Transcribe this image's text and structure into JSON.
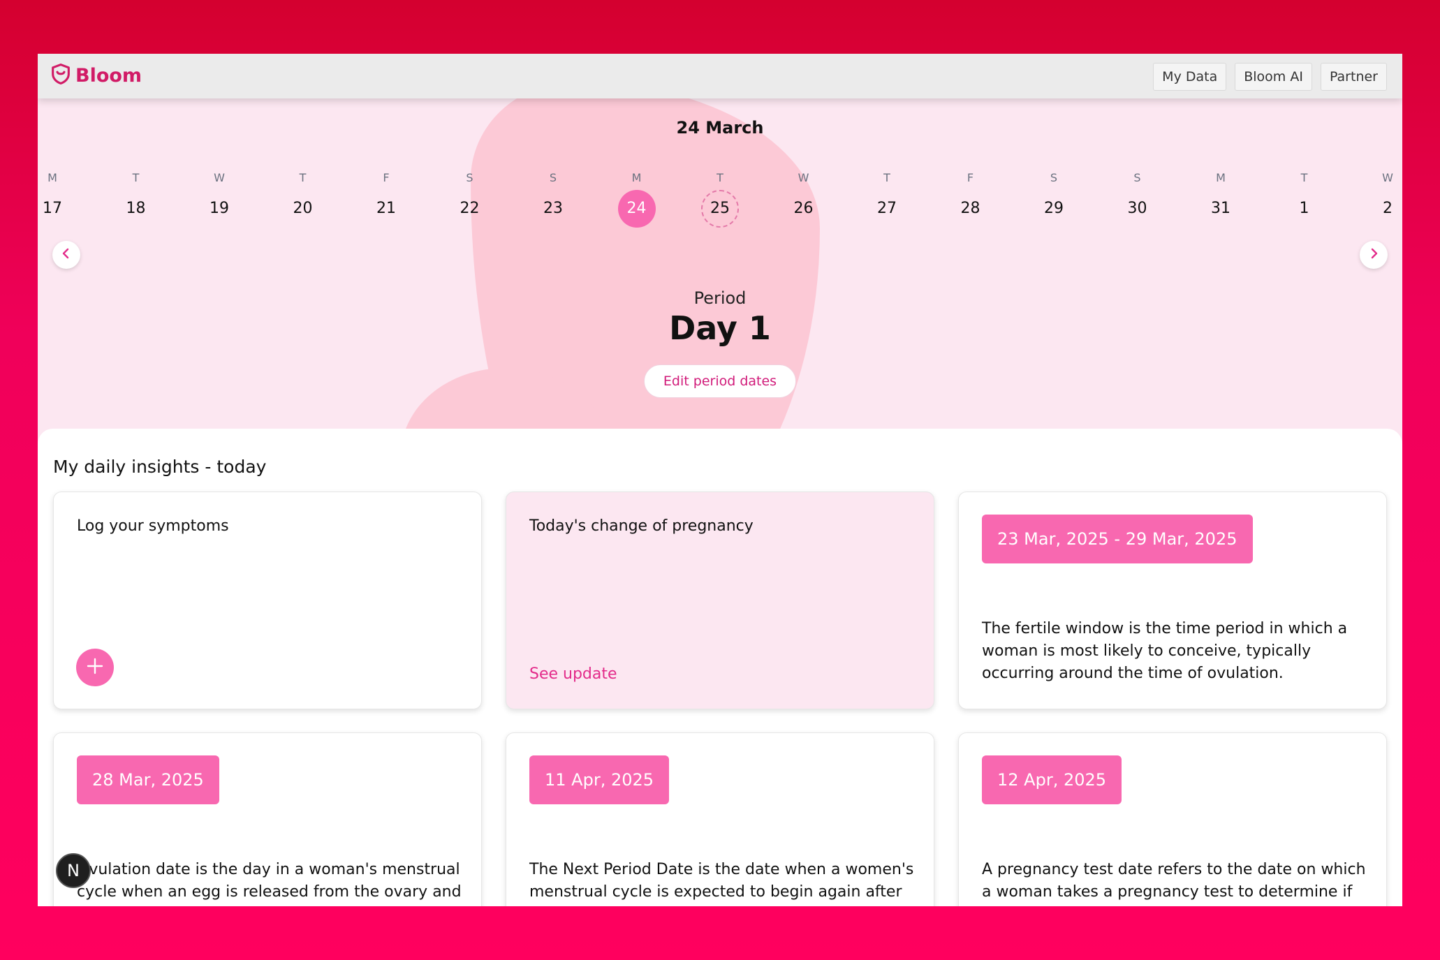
{
  "header": {
    "brand": "Bloom",
    "nav": [
      {
        "label": "My Data"
      },
      {
        "label": "Bloom AI"
      },
      {
        "label": "Partner"
      }
    ]
  },
  "calendar": {
    "title": "24 March",
    "days": [
      {
        "letter": "M",
        "num": "17"
      },
      {
        "letter": "T",
        "num": "18"
      },
      {
        "letter": "W",
        "num": "19"
      },
      {
        "letter": "T",
        "num": "20"
      },
      {
        "letter": "F",
        "num": "21"
      },
      {
        "letter": "S",
        "num": "22"
      },
      {
        "letter": "S",
        "num": "23"
      },
      {
        "letter": "M",
        "num": "24",
        "state": "selected"
      },
      {
        "letter": "T",
        "num": "25",
        "state": "next"
      },
      {
        "letter": "W",
        "num": "26"
      },
      {
        "letter": "T",
        "num": "27"
      },
      {
        "letter": "F",
        "num": "28"
      },
      {
        "letter": "S",
        "num": "29"
      },
      {
        "letter": "S",
        "num": "30"
      },
      {
        "letter": "M",
        "num": "31"
      },
      {
        "letter": "T",
        "num": "1"
      },
      {
        "letter": "W",
        "num": "2"
      }
    ]
  },
  "status": {
    "label": "Period",
    "day": "Day 1",
    "edit_button": "Edit period dates"
  },
  "insights": {
    "title": "My daily insights - today",
    "log_card": {
      "title": "Log your symptoms"
    },
    "pregnancy_card": {
      "title": "Today's change of pregnancy",
      "link": "See update"
    },
    "fertile_card": {
      "badge": "23 Mar, 2025 - 29 Mar, 2025",
      "text": "The fertile window is the time period in which a woman is most likely to conceive, typically occurring around the time of ovulation."
    },
    "ovulation_card": {
      "badge": "28 Mar, 2025",
      "text": "Ovulation date is the day in a woman's menstrual cycle when an egg is released from the ovary and can"
    },
    "next_period_card": {
      "badge": "11 Apr, 2025",
      "text": "The Next Period Date is the date when a women's menstrual cycle is expected to begin again after the"
    },
    "test_card": {
      "badge": "12 Apr, 2025",
      "text": "A pregnancy test date refers to the date on which a woman takes a pregnancy test to determine if she is"
    }
  },
  "floating_badge": "N",
  "colors": {
    "accent": "#f868b0",
    "brand": "#d11b66",
    "background": "#fce7f1"
  }
}
